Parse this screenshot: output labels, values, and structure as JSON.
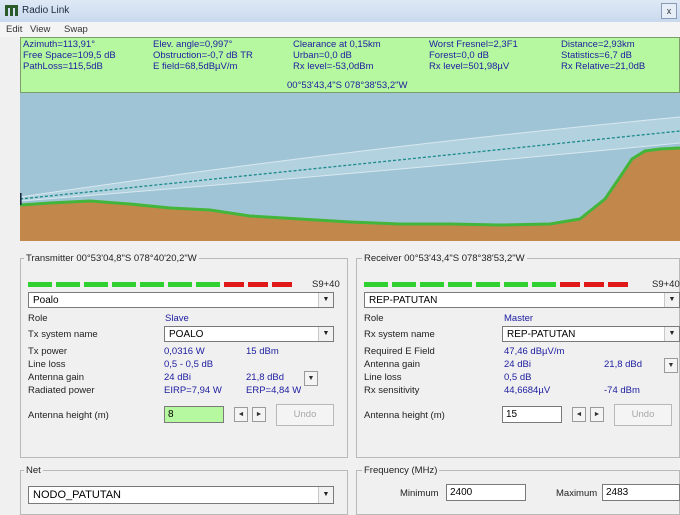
{
  "window": {
    "title": "Radio Link",
    "close_label": "x"
  },
  "menu": [
    "Edit",
    "View",
    "Swap"
  ],
  "info": {
    "azimuth": "Azimuth=113,91°",
    "free_space": "Free Space=109,5 dB",
    "path_loss": "PathLoss=115,5dB",
    "elev_angle": "Elev. angle=0,997°",
    "obstruction": "Obstruction=-0,7 dB TR",
    "e_field": "E field=68,5dBµV/m",
    "clearance": "Clearance at 0,15km",
    "urban": "Urban=0,0 dB",
    "rx_level_db": "Rx level=-53,0dBm",
    "worst_fresnel": "Worst Fresnel=2,3F1",
    "forest": "Forest=0,0 dB",
    "rx_level_uv": "Rx level=501,98µV",
    "distance": "Distance=2,93km",
    "statistics": "Statistics=6,7 dB",
    "rx_relative": "Rx Relative=21,0dB"
  },
  "profile": {
    "coordinate_readout": "00°53'43,4\"S 078°38'53,2\"W"
  },
  "transmitter": {
    "title": "Transmitter 00°53'04,8\"S 078°40'20,2\"W",
    "meter_value": "S9+40",
    "site": "Poalo",
    "role_label": "Role",
    "role_value": "Slave",
    "system_label": "Tx system name",
    "system_value": "POALO",
    "power_label": "Tx power",
    "power_w": "0,0316 W",
    "power_dbm": "15 dBm",
    "line_loss_label": "Line loss",
    "line_loss_value": "0,5 - 0,5 dB",
    "gain_label": "Antenna gain",
    "gain_dbi": "24 dBi",
    "gain_dbd": "21,8 dBd",
    "radiated_label": "Radiated power",
    "eirp": "EIRP=7,94 W",
    "erp": "ERP=4,84 W",
    "height_label": "Antenna height (m)",
    "height_value": "8",
    "undo_label": "Undo"
  },
  "receiver": {
    "title": "Receiver 00°53'43,4\"S 078°38'53,2\"W",
    "meter_value": "S9+40",
    "site": "REP-PATUTAN",
    "role_label": "Role",
    "role_value": "Master",
    "system_label": "Rx system name",
    "system_value": "REP-PATUTAN",
    "req_field_label": "Required E Field",
    "req_field_value": "47,46 dBµV/m",
    "gain_label": "Antenna gain",
    "gain_dbi": "24 dBi",
    "gain_dbd": "21,8 dBd",
    "line_loss_label": "Line loss",
    "line_loss_value": "0,5 dB",
    "sensitivity_label": "Rx sensitivity",
    "sensitivity_uv": "44,6684µV",
    "sensitivity_dbm": "-74 dBm",
    "height_label": "Antenna height (m)",
    "height_value": "15",
    "undo_label": "Undo"
  },
  "net": {
    "title": "Net",
    "value": "NODO_PATUTAN"
  },
  "frequency": {
    "title": "Frequency (MHz)",
    "min_label": "Minimum",
    "min_value": "2400",
    "max_label": "Maximum",
    "max_value": "2483"
  },
  "colors": {
    "info_bg": "#b6f8a0",
    "sky": "#9fc4d6",
    "terrain": "#c2874a",
    "vegetation": "#43b53a",
    "link_line": "#1a8a8a",
    "meter_green": "#2fd02f",
    "meter_red": "#e01818"
  }
}
